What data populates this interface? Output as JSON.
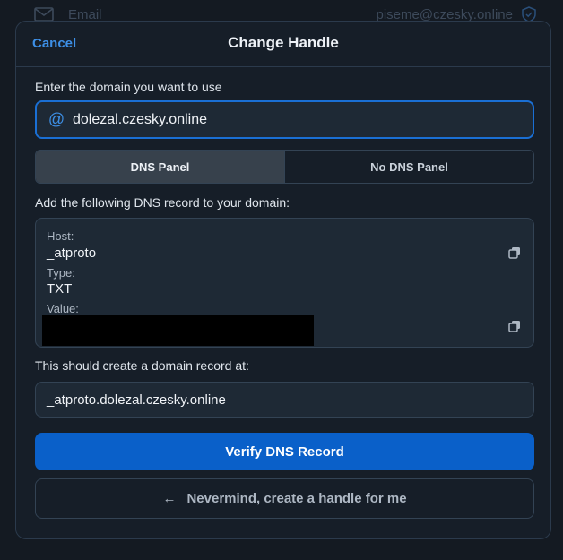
{
  "background": {
    "email_label": "Email",
    "email_value": "piseme@czesky.online"
  },
  "modal": {
    "cancel_label": "Cancel",
    "title": "Change Handle"
  },
  "domain": {
    "prompt": "Enter the domain you want to use",
    "value": "dolezal.czesky.online",
    "icon": "at-icon"
  },
  "tabs": [
    {
      "label": "DNS Panel",
      "active": true
    },
    {
      "label": "No DNS Panel",
      "active": false
    }
  ],
  "dns": {
    "instruction": "Add the following DNS record to your domain:",
    "host_label": "Host:",
    "host_value": "_atproto",
    "type_label": "Type:",
    "type_value": "TXT",
    "value_label": "Value:"
  },
  "record": {
    "prompt": "This should create a domain record at:",
    "value": "_atproto.dolezal.czesky.online"
  },
  "buttons": {
    "verify_label": "Verify DNS Record",
    "nevermind_label": "Nevermind, create a handle for me"
  },
  "colors": {
    "accent": "#0a60c9",
    "link": "#3d8fe6",
    "background": "#141a22",
    "surface": "#1e2935"
  }
}
